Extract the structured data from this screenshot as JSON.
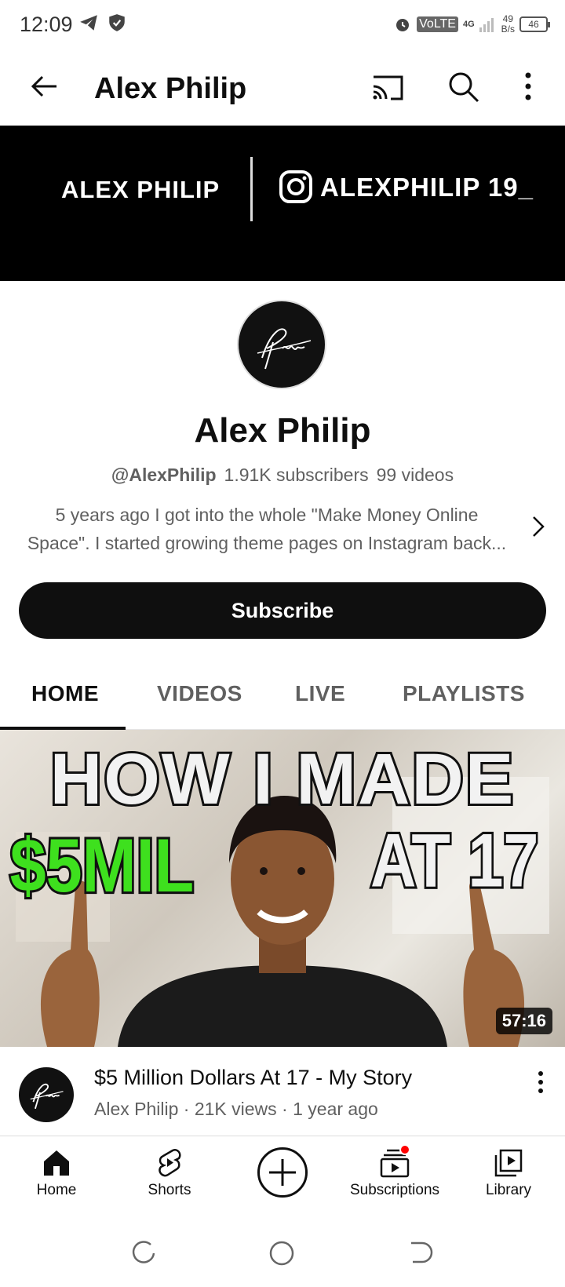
{
  "status_bar": {
    "time": "12:09",
    "volte": "VoLTE",
    "network": "4G",
    "speed_value": "49",
    "speed_unit": "B/s",
    "battery": "46"
  },
  "appbar": {
    "title": "Alex Philip"
  },
  "banner": {
    "left_text": "ALEX PHILIP",
    "right_text": "ALEXPHILIP 19_"
  },
  "channel": {
    "name": "Alex Philip",
    "handle": "@AlexPhilip",
    "subscribers": "1.91K subscribers",
    "videos": "99 videos",
    "description_line1": "5 years ago I got into the whole \"Make Money Online",
    "description_line2": "Space\". I started growing theme pages on Instagram back...",
    "subscribe_label": "Subscribe",
    "avatar_text": "Philip"
  },
  "tabs": [
    {
      "label": "HOME",
      "active": true
    },
    {
      "label": "VIDEOS",
      "active": false
    },
    {
      "label": "LIVE",
      "active": false
    },
    {
      "label": "PLAYLISTS",
      "active": false
    }
  ],
  "video": {
    "thumb_line1": "HOW I MADE",
    "thumb_money": "$5MIL",
    "thumb_age": "AT 17",
    "duration": "57:16",
    "title": "$5 Million Dollars At 17 - My Story",
    "meta": "Alex Philip · 21K views · 1 year ago"
  },
  "bottom_nav": [
    {
      "label": "Home",
      "icon": "home-icon"
    },
    {
      "label": "Shorts",
      "icon": "shorts-icon"
    },
    {
      "label": "",
      "icon": "create-icon"
    },
    {
      "label": "Subscriptions",
      "icon": "subscriptions-icon"
    },
    {
      "label": "Library",
      "icon": "library-icon"
    }
  ],
  "colors": {
    "text_primary": "#0f0f0f",
    "text_secondary": "#606060",
    "accent_red": "#ff0000",
    "money_green": "#3ee01e"
  }
}
